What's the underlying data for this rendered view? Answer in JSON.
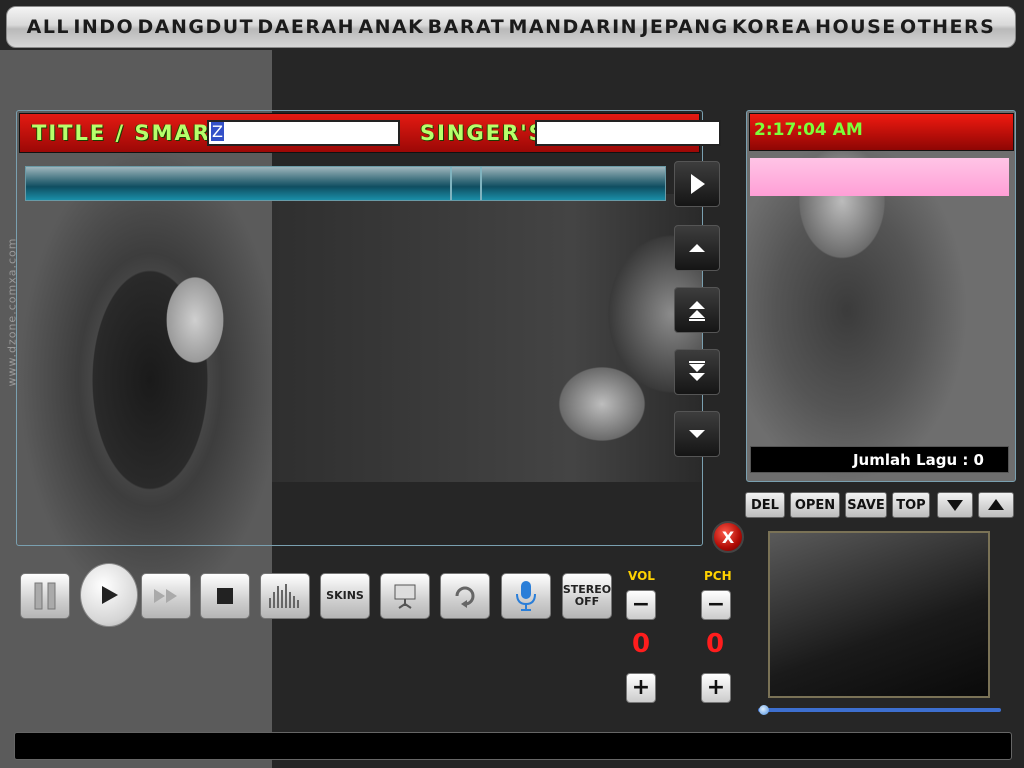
{
  "watermark": "www.dzone.comxa.com",
  "categories": [
    "ALL",
    "INDO",
    "DANGDUT",
    "DAERAH",
    "ANAK",
    "BARAT",
    "MANDARIN",
    "JEPANG",
    "KOREA",
    "HOUSE",
    "OTHERS"
  ],
  "search": {
    "title_label": "TITLE / SMART",
    "title_value": "Z",
    "singer_label": "SINGER'S",
    "singer_value": ""
  },
  "list_nav": {
    "icons": [
      "play-right-icon",
      "page-up-icon",
      "page-up-double-icon",
      "page-down-double-icon",
      "page-down-icon"
    ]
  },
  "close_label": "X",
  "right_panel": {
    "clock": "2:17:04 AM",
    "jumlah_label": "Jumlah Lagu : 0",
    "buttons": {
      "del": "DEL",
      "open": "OPEN",
      "save": "SAVE",
      "top": "TOP"
    }
  },
  "controls": {
    "skins_label": "SKINS",
    "stereo_label_1": "STEREO",
    "stereo_label_2": "OFF"
  },
  "vol": {
    "label": "VOL",
    "value": "0",
    "minus": "−",
    "plus": "+"
  },
  "pch": {
    "label": "PCH",
    "value": "0",
    "minus": "−",
    "plus": "+"
  },
  "colors": {
    "accent_red": "#e31a12",
    "label_green": "#b7ff6b",
    "clock_green": "#7cff3a",
    "meter_yellow": "#ffd200",
    "meter_red": "#ff1d1d"
  }
}
